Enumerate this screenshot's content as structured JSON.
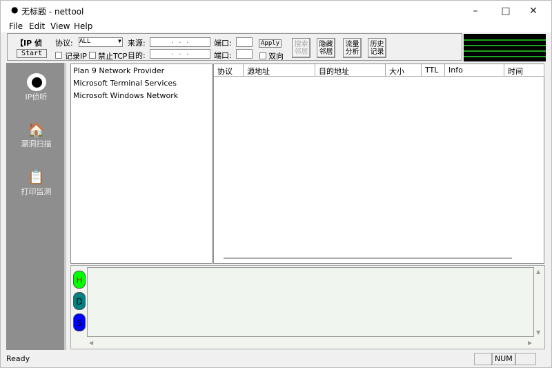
{
  "window": {
    "title": "无标题 - nettool",
    "minimize": "–",
    "maximize": "□",
    "close": "✕"
  },
  "menu": [
    "File",
    "Edit",
    "View",
    "Help"
  ],
  "toolbar": {
    "mode_label": "【IP 侦",
    "start_label": "Start",
    "protocol_label": "协议:",
    "protocol_value": "ALL",
    "source_label": "来源:",
    "source_ip": ". . .",
    "dest_label": "目的:",
    "dest_ip": ". . .",
    "port_label": "端口:",
    "port2_label": "端口:",
    "apply_label": "Apply",
    "record_ip_label": "记录IP",
    "block_tcp_label": "禁止TCP",
    "bidirectional_label": "双向",
    "search_neighbors": "搜索邻居",
    "hide_neighbors": "隐藏邻居",
    "traffic_analysis": "流量分析",
    "history": "历史记录"
  },
  "sidebar": [
    {
      "label": "IP侦听",
      "icon": "eye-icon"
    },
    {
      "label": "漏洞扫描",
      "icon": "house-clock-icon"
    },
    {
      "label": "打印监测",
      "icon": "clipboard-icon"
    }
  ],
  "providers": [
    "Plan 9 Network Provider",
    "Microsoft Terminal Services",
    "Microsoft Windows Network"
  ],
  "table": {
    "columns": [
      "协议",
      "源地址",
      "目的地址",
      "大小",
      "TTL",
      "Info",
      "时间"
    ]
  },
  "bottom": {
    "buttons": [
      {
        "label": "H",
        "color": "#00ff00",
        "text": "#e00000"
      },
      {
        "label": "D",
        "color": "#008080",
        "text": "#000000"
      },
      {
        "label": "S",
        "color": "#0000ff",
        "text": "#000000"
      }
    ]
  },
  "status": {
    "text": "Ready",
    "num": "NUM"
  }
}
